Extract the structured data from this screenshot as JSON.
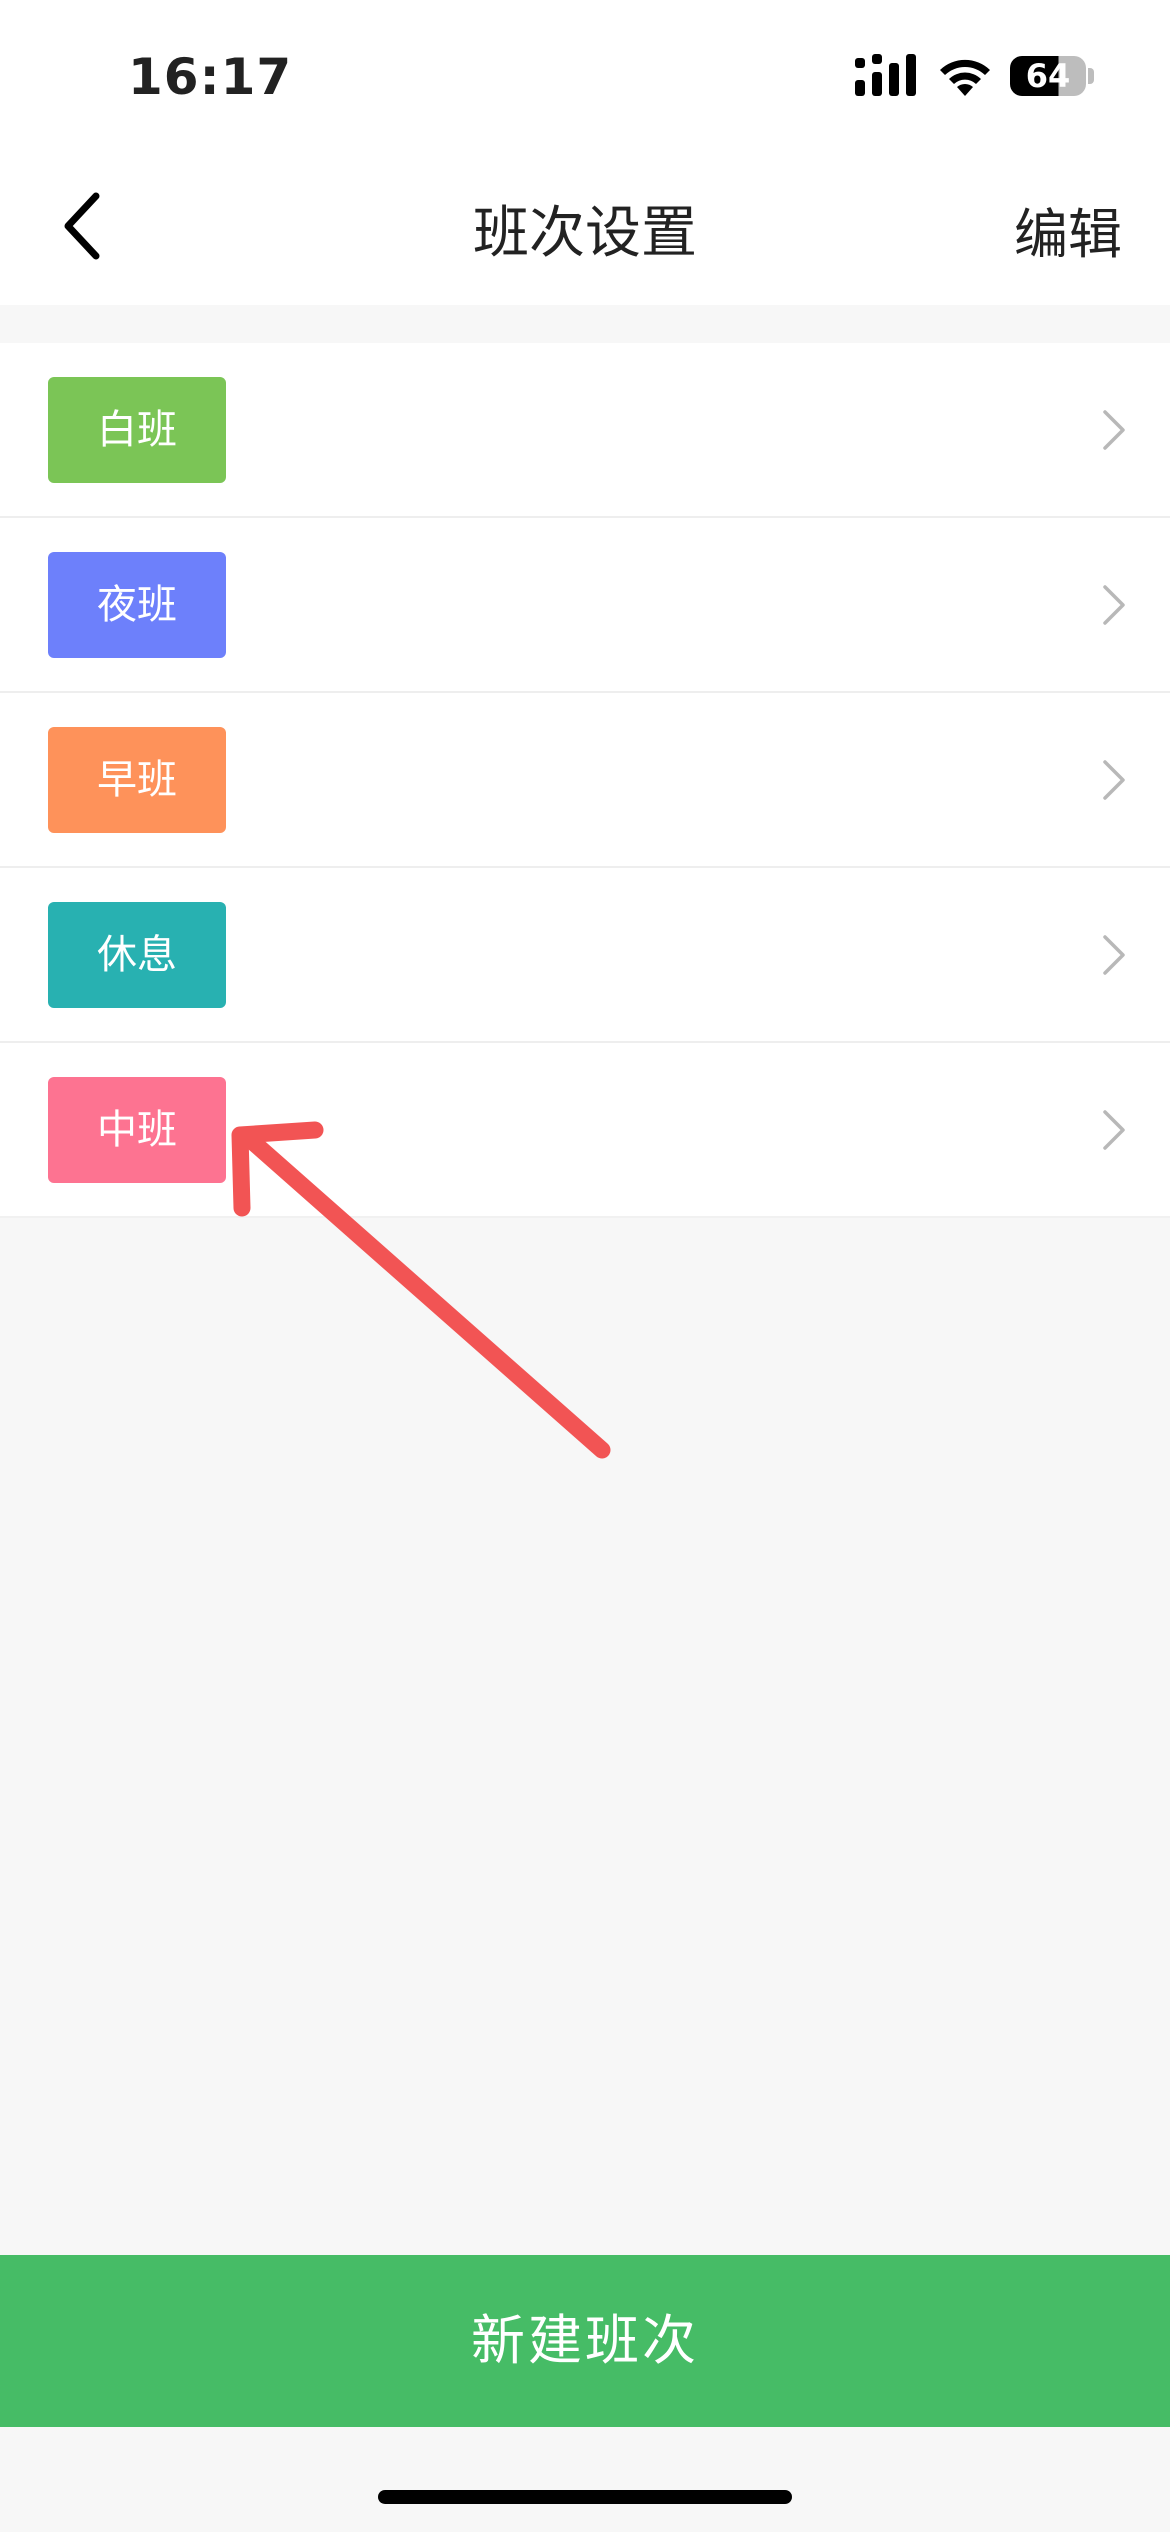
{
  "status_bar": {
    "time": "16:17",
    "battery": "64"
  },
  "nav": {
    "title": "班次设置",
    "edit_label": "编辑"
  },
  "shifts": [
    {
      "name": "白班",
      "color": "#7bc556"
    },
    {
      "name": "夜班",
      "color": "#6d80fb"
    },
    {
      "name": "早班",
      "color": "#fe925a"
    },
    {
      "name": "休息",
      "color": "#28b1b1"
    },
    {
      "name": "中班",
      "color": "#fd7391"
    }
  ],
  "footer": {
    "new_shift_label": "新建班次"
  },
  "colors": {
    "primary_green": "#46bc66",
    "annotation_red": "#f25454"
  }
}
